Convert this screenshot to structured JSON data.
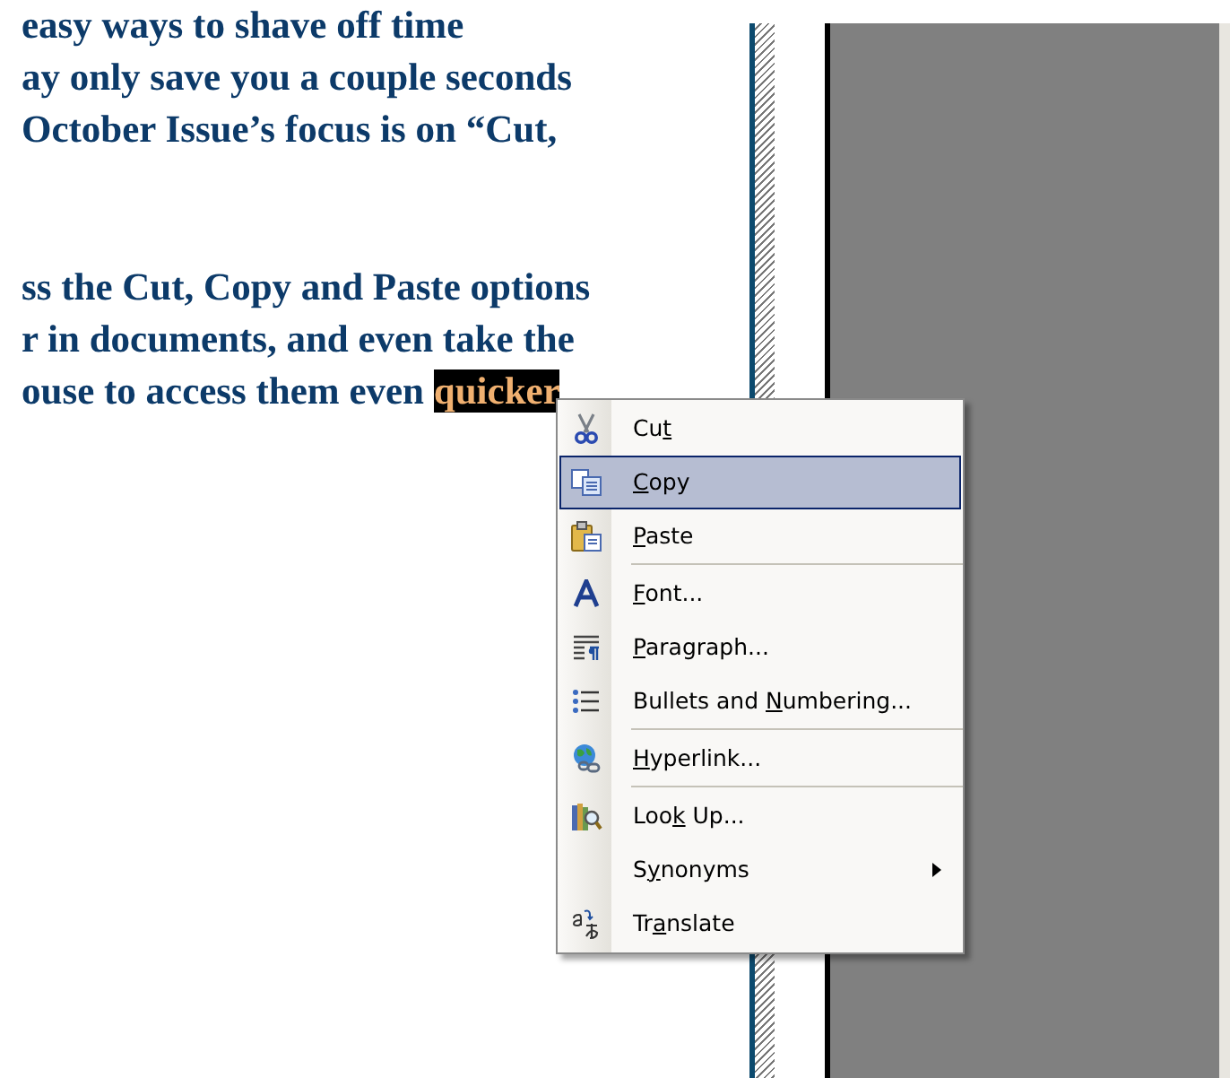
{
  "document": {
    "paragraphs": [
      {
        "lines": [
          "easy ways to shave off time",
          "ay only save you a couple seconds",
          "October Issue’s focus is on “Cut,"
        ]
      },
      {
        "lines": [
          "ss the Cut, Copy and Paste options",
          "r in documents, and even take the",
          "ouse to access them even"
        ],
        "highlighted_word": "quicker"
      }
    ]
  },
  "context_menu": {
    "items": [
      {
        "kind": "item",
        "before": "Cu",
        "key": "t",
        "selected": false,
        "submenu": false
      },
      {
        "kind": "item",
        "key": "C",
        "after": "opy",
        "selected": true,
        "submenu": false
      },
      {
        "kind": "item",
        "key": "P",
        "after": "aste",
        "selected": false,
        "submenu": false
      },
      {
        "kind": "separator"
      },
      {
        "kind": "item",
        "key": "F",
        "after": "ont...",
        "selected": false,
        "submenu": false
      },
      {
        "kind": "item",
        "key": "P",
        "after": "aragraph...",
        "selected": false,
        "submenu": false
      },
      {
        "kind": "item",
        "before": "Bullets and ",
        "key": "N",
        "after": "umbering...",
        "selected": false,
        "submenu": false
      },
      {
        "kind": "separator"
      },
      {
        "kind": "item",
        "key": "H",
        "after": "yperlink...",
        "selected": false,
        "submenu": false
      },
      {
        "kind": "separator"
      },
      {
        "kind": "item",
        "before": "Loo",
        "key": "k",
        "after": " Up...",
        "selected": false,
        "submenu": false
      },
      {
        "kind": "item",
        "before": "S",
        "key": "y",
        "after": "nonyms",
        "selected": false,
        "submenu": true
      },
      {
        "kind": "item",
        "before": "Tr",
        "key": "a",
        "after": "nslate",
        "selected": false,
        "submenu": false
      }
    ]
  }
}
